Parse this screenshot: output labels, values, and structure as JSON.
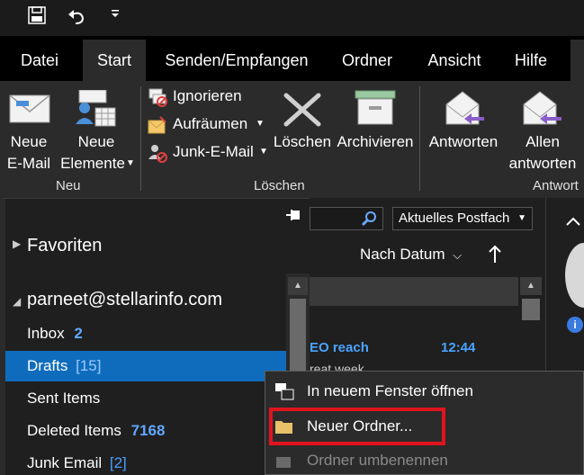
{
  "quick_access": {
    "save_icon": "save-icon",
    "undo_icon": "undo-icon",
    "customize_icon": "customize-arrow-icon"
  },
  "tabs": [
    {
      "label": "Datei"
    },
    {
      "label": "Start"
    },
    {
      "label": "Senden/Empfangen"
    },
    {
      "label": "Ordner"
    },
    {
      "label": "Ansicht"
    },
    {
      "label": "Hilfe"
    }
  ],
  "ribbon": {
    "new_email": {
      "line1": "Neue",
      "line2": "E-Mail"
    },
    "new_items": {
      "line1": "Neue",
      "line2": "Elemente"
    },
    "group_new": "Neu",
    "ignore": "Ignorieren",
    "cleanup": "Aufräumen",
    "junk": "Junk-E-Mail",
    "delete": "Löschen",
    "archive": "Archivieren",
    "group_delete": "Löschen",
    "reply": "Antworten",
    "reply_all": {
      "line1": "Allen",
      "line2": "antworten"
    },
    "group_respond": "Antwort"
  },
  "folder_pane": {
    "favorites": "Favoriten",
    "account": "parneet@stellarinfo.com",
    "folders": [
      {
        "name": "Inbox",
        "count": "2",
        "style": "bold"
      },
      {
        "name": "Drafts",
        "count": "[15]",
        "style": "bracket"
      },
      {
        "name": "Sent Items",
        "count": "",
        "style": "none"
      },
      {
        "name": "Deleted Items",
        "count": "7168",
        "style": "bold"
      },
      {
        "name": "Junk Email",
        "count": "[2]",
        "style": "bracket"
      }
    ]
  },
  "message_list": {
    "scope": "Aktuelles Postfach",
    "sort": "Nach Datum",
    "message_sender": "EO reach",
    "message_time": "12:44",
    "message_preview": "reat week"
  },
  "context_menu": {
    "items": [
      {
        "label": "In neuem Fenster öffnen",
        "enabled": true
      },
      {
        "label": "Neuer Ordner...",
        "enabled": true,
        "highlighted": true
      },
      {
        "label": "Ordner umbenennen",
        "enabled": false
      }
    ],
    "highlight_color": "#e0141e"
  }
}
